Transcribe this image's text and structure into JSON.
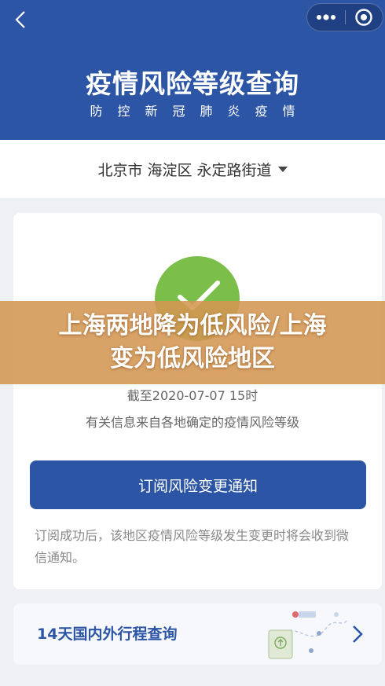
{
  "header": {
    "title": "疫情风险等级查询",
    "subtitle": "防控新冠肺炎疫情"
  },
  "location": {
    "text": "北京市 海淀区 永定路街道"
  },
  "banner": {
    "line1": "上海两地降为低风险/上海",
    "line2": "变为低风险地区"
  },
  "status": {
    "as_of": "截至2020-07-07 15时",
    "source_note": "有关信息来自各地确定的疫情风险等级"
  },
  "subscribe": {
    "button_label": "订阅风险变更通知",
    "note": "订阅成功后，该地区疫情风险等级发生变更时将会收到微信通知。"
  },
  "trip": {
    "label": "14天国内外行程查询"
  },
  "colors": {
    "primary": "#2c55a5",
    "status_low_risk": "#7bbf4a",
    "banner": "#d39652"
  },
  "icons": {
    "back": "chevron-left-icon",
    "more": "more-dots-icon",
    "close": "target-circle-icon",
    "dropdown": "caret-down-icon",
    "status": "check-icon",
    "trip_arrow": "chevron-right-icon"
  }
}
